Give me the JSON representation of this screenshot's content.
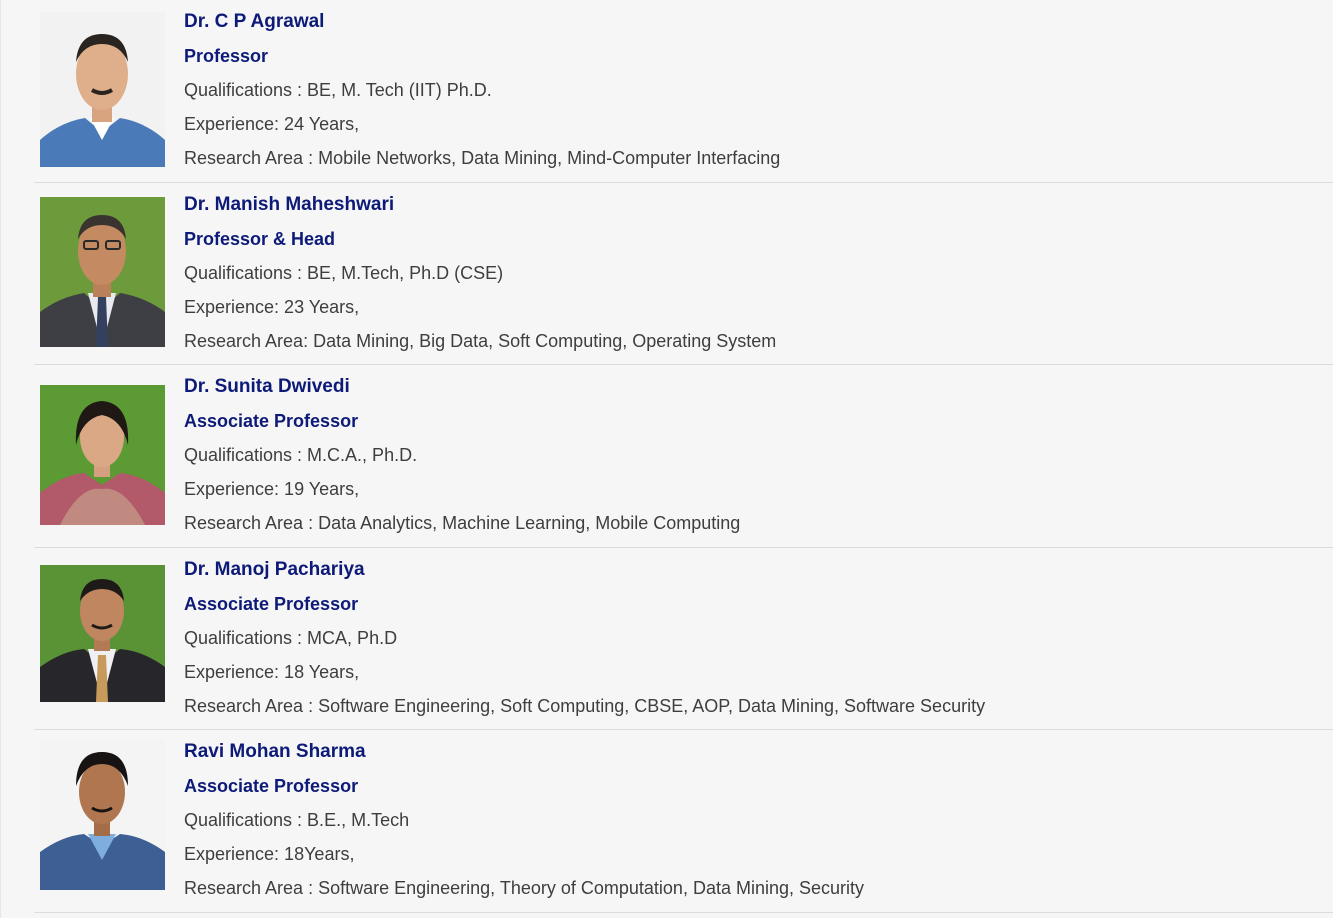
{
  "faculty": [
    {
      "name": "Dr. C P Agrawal",
      "designation": "Professor",
      "qualifications": "Qualifications : BE, M. Tech (IIT) Ph.D.",
      "experience": "Experience: 24 Years,",
      "research": "Research Area : Mobile Networks, Data Mining, Mind-Computer Interfacing"
    },
    {
      "name": "Dr. Manish Maheshwari",
      "designation": "Professor & Head",
      "qualifications": "Qualifications : BE, M.Tech, Ph.D (CSE)",
      "experience": "Experience: 23 Years,",
      "research": "Research Area: Data Mining, Big Data, Soft Computing, Operating System"
    },
    {
      "name": "Dr. Sunita Dwivedi",
      "designation": "Associate Professor",
      "qualifications": "Qualifications : M.C.A., Ph.D.",
      "experience": "Experience: 19 Years,",
      "research": "Research Area : Data Analytics, Machine Learning, Mobile Computing"
    },
    {
      "name": "Dr. Manoj Pachariya",
      "designation": "Associate Professor",
      "qualifications": "Qualifications : MCA, Ph.D",
      "experience": "Experience: 18 Years,",
      "research": "Research Area : Software Engineering, Soft Computing, CBSE, AOP, Data Mining, Software Security"
    },
    {
      "name": "Ravi Mohan Sharma",
      "designation": "Associate Professor",
      "qualifications": "Qualifications : B.E., M.Tech",
      "experience": "Experience: 18Years,",
      "research": "Research Area : Software Engineering, Theory of Computation, Data Mining, Security"
    }
  ],
  "colors": {
    "name_text": "#0d1a78",
    "body_text": "#3e3e3e",
    "background": "#f6f6f6",
    "divider": "#dcdcdc"
  },
  "photo_backgrounds": [
    "#f2f2f2",
    "#6d9a3a",
    "#5c9a34",
    "#5a9236",
    "#f4f4f4"
  ]
}
